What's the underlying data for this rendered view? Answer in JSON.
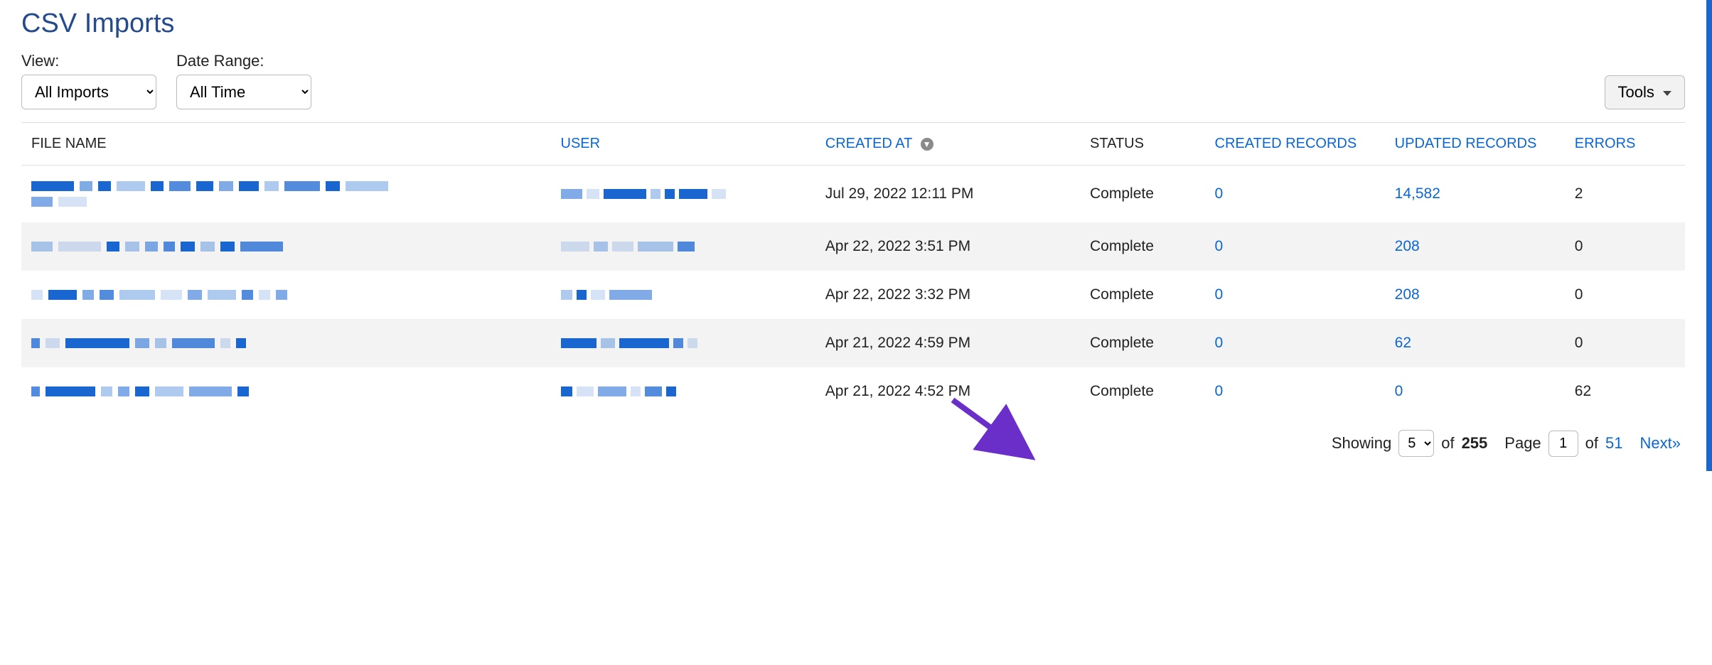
{
  "page": {
    "title": "CSV Imports"
  },
  "filters": {
    "view_label": "View:",
    "view_value": "All Imports",
    "date_range_label": "Date Range:",
    "date_range_value": "All Time"
  },
  "tools": {
    "label": "Tools"
  },
  "columns": {
    "file_name": "FILE NAME",
    "user": "USER",
    "created_at": "CREATED AT",
    "status": "STATUS",
    "created_records": "CREATED RECORDS",
    "updated_records": "UPDATED RECORDS",
    "errors": "ERRORS"
  },
  "rows": [
    {
      "created_at": "Jul 29, 2022 12:11 PM",
      "status": "Complete",
      "created_records": "0",
      "updated_records": "14,582",
      "errors": "2"
    },
    {
      "created_at": "Apr 22, 2022 3:51 PM",
      "status": "Complete",
      "created_records": "0",
      "updated_records": "208",
      "errors": "0"
    },
    {
      "created_at": "Apr 22, 2022 3:32 PM",
      "status": "Complete",
      "created_records": "0",
      "updated_records": "208",
      "errors": "0"
    },
    {
      "created_at": "Apr 21, 2022 4:59 PM",
      "status": "Complete",
      "created_records": "0",
      "updated_records": "62",
      "errors": "0"
    },
    {
      "created_at": "Apr 21, 2022 4:52 PM",
      "status": "Complete",
      "created_records": "0",
      "updated_records": "0",
      "errors": "62"
    }
  ],
  "pagination": {
    "showing_label": "Showing",
    "per_page": "5",
    "of_label": "of",
    "total": "255",
    "page_label": "Page",
    "current_page": "1",
    "total_pages": "51",
    "next_label": "Next»"
  }
}
